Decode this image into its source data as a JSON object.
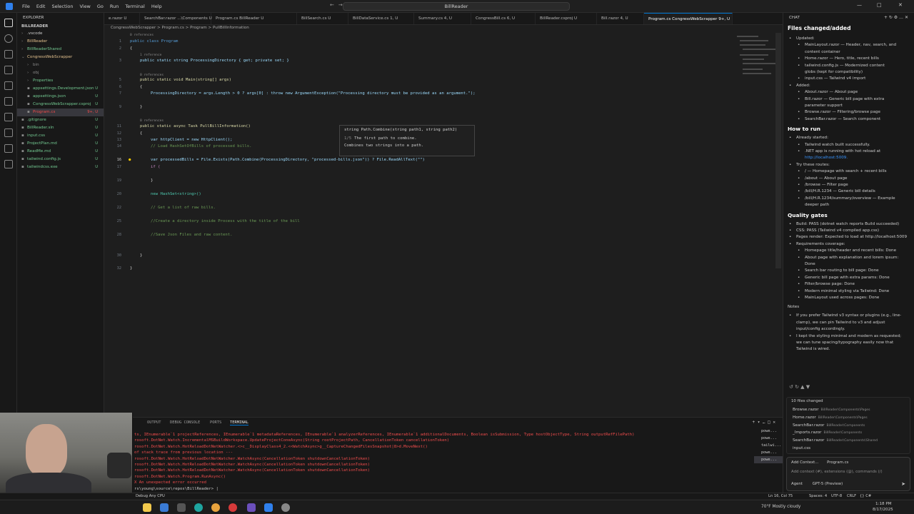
{
  "titlebar": {
    "menu": [
      "File",
      "Edit",
      "Selection",
      "View",
      "Go",
      "Run",
      "Terminal",
      "Help"
    ],
    "search": "BillReader"
  },
  "explorer": {
    "header": "EXPLORER",
    "section": "BILLREADER",
    "items": [
      {
        "label": ".vscode",
        "status": "",
        "color": "#cccccc"
      },
      {
        "label": "BillReader",
        "status": "",
        "color": "#e2c08d"
      },
      {
        "label": "BillReaderShared",
        "status": "",
        "color": "#73c991"
      },
      {
        "label": "CongressWebScrapper",
        "status": "",
        "color": "#e2c08d"
      },
      {
        "label": "bin",
        "status": "",
        "color": "#8b8b8b"
      },
      {
        "label": "obj",
        "status": "",
        "color": "#8b8b8b"
      },
      {
        "label": "Properties",
        "status": "",
        "color": "#73c991"
      },
      {
        "label": "appsettings.Development.json",
        "status": "U",
        "color": "#73c991"
      },
      {
        "label": "appsettings.json",
        "status": "U",
        "color": "#73c991"
      },
      {
        "label": "CongressWebScrapper.csproj",
        "status": "U",
        "color": "#73c991"
      },
      {
        "label": "Program.cs",
        "status": "9+, U",
        "color": "#f14c4c"
      },
      {
        "label": ".gitignore",
        "status": "U",
        "color": "#73c991"
      },
      {
        "label": "BillReader.sln",
        "status": "U",
        "color": "#73c991"
      },
      {
        "label": "input.css",
        "status": "U",
        "color": "#73c991"
      },
      {
        "label": "ProjectPlan.md",
        "status": "U",
        "color": "#73c991"
      },
      {
        "label": "ReadMe.md",
        "status": "U",
        "color": "#73c991"
      },
      {
        "label": "tailwind.config.js",
        "status": "U",
        "color": "#73c991"
      },
      {
        "label": "tailwindcss.exe",
        "status": "U",
        "color": "#73c991"
      }
    ]
  },
  "tabs": [
    {
      "label": "e.razor U"
    },
    {
      "label": "SearchBar.razor ...\\Components U"
    },
    {
      "label": "Program.cs BillReader U"
    },
    {
      "label": "BillSearch.cs U"
    },
    {
      "label": "BillDataService.cs 1, U"
    },
    {
      "label": "Summary.cs 4, U"
    },
    {
      "label": "CongressBill.cs 6, U"
    },
    {
      "label": "BillReader.csproj U"
    },
    {
      "label": "Bill.razor 4, U"
    },
    {
      "label": "Program.cs CongressWebScrapper 9+, U"
    }
  ],
  "breadcrumb": "CongressWebScrapper > Program.cs > Program > PullBillInformation",
  "code": {
    "lens": {
      "ref0": "0 references",
      "ref1": "1 reference",
      "ref0b": "0 references",
      "ref0c": "0 references"
    },
    "lines": {
      "l1": "public class Program",
      "l3": "public static string ProcessingDirectory { get; private set; }",
      "l5": "public static void Main(string[] args)",
      "l7": "ProcessingDirectory = args.Length > 0 ? args[0] : throw new ArgumentException(\"Processing directory must be provided as an argument.\");",
      "l11": "public static async Task PullBillInformation()",
      "l13": "var httpClient = new HttpClient();",
      "l14": "// Load HashSetOfBills of processed bills.",
      "l16": "var processedBills = File.Exists(Path.Combine(ProcessingDirectory, \"processed-bills.json\")) ? File.ReadAllText(\"\")",
      "l17": "if (",
      "l20": "new HashSet<string>()",
      "l22": "// Get a list of raw bills.",
      "l25": "//Create a directory inside Process with the title of the bill",
      "l28": "//Save Json Files and raw content."
    }
  },
  "hover": {
    "signature": "string Path.Combine(string path1, string path2)",
    "overload": "1/5",
    "param_doc": "The first path to combine.",
    "summary": "Combines two strings into a path."
  },
  "panel": {
    "tabs": [
      "OUTPUT",
      "DEBUG CONSOLE",
      "PORTS",
      "TERMINAL"
    ],
    "terminal_lines": [
      "ts, IEnumerable`1 projectReferences, IEnumerable`1 metadataReferences, IEnumerable`1 analyzerReferences, IEnumerable`1 additionalDocuments, Boolean isSubmission, Type hostObjectType, String outputRefFilePath)",
      "rosoft.DotNet.Watch.IncrementalMSBuildWorkspace.UpdateProjectConeAsync(String rootProjectPath, CancellationToken cancellationToken)",
      "rosoft.DotNet.Watch.HotReloadDotNetWatcher.<>c__DisplayClass4_2.<<WatchAsync>g__CaptureChangedFilesSnapshot|8>d.MoveNext()",
      "of stack trace from previous location ---",
      "rosoft.DotNet.Watch.HotReloadDotNetWatcher.WatchAsync(CancellationToken shutdownCancellationToken)",
      "rosoft.DotNet.Watch.HotReloadDotNetWatcher.WatchAsync(CancellationToken shutdownCancellationToken)",
      "rosoft.DotNet.Watch.HotReloadDotNetWatcher.WatchAsync(CancellationToken shutdownCancellationToken)",
      "rosoft.DotNet.Watch.Program.RunAsync()",
      "X An unexpected error occurred",
      "rs\\young\\source\\repos\\BillReader> |"
    ],
    "terminal_list": [
      "powe...",
      "powe...",
      "tailwi...",
      "powe...",
      "powe..."
    ]
  },
  "chat": {
    "title": "CHAT",
    "files_heading": "Files changed/added",
    "updated_label": "Updated:",
    "updated": [
      "MainLayout.razor — Header, nav, search, and",
      "content container",
      "Home.razor — Hero, title, recent bills",
      "tailwind.config.js — Modernized content",
      "globs (kept for compatibility)",
      "input.css — Tailwind v4 import"
    ],
    "added_label": "Added:",
    "added": [
      "About.razor — About page",
      "Bill.razor — Generic bill page with extra",
      "parameter support",
      "Browse.razor — Filtering/browse page",
      "SearchBar.razor — Search component"
    ],
    "how_heading": "How to run",
    "already_started": "Already started:",
    "how": [
      "Tailwind watch built successfully.",
      ".NET app is running with hot reload at",
      "http://localhost:5009."
    ],
    "try_routes": "Try these routes:",
    "routes": [
      "/ — Homepage with search + recent bills",
      "/about — About page",
      "/browse — Filter page",
      "/bill/H.R.1234 — Generic bill details",
      "/bill/H.R.1234/summary/overview — Example",
      "deeper path"
    ],
    "quality_heading": "Quality gates",
    "quality": [
      "Build: PASS (dotnet watch reports Build succeeded)",
      "CSS: PASS (Tailwind v4 compiled app.css)",
      "Pages render: Expected to load at http://localhost:5009",
      "Requirements coverage:",
      "Homepage title/header and recent bills: Done",
      "About page with explanation and lorem ipsum:",
      "Done",
      "Search bar routing to bill page: Done",
      "Generic bill page with extra params: Done",
      "Filter/browse page: Done",
      "Modern minimal styling via Tailwind: Done",
      "MainLayout used across pages: Done"
    ],
    "notes_heading": "Notes",
    "notes": [
      "If you prefer Tailwind v3 syntax or plugins (e.g., line-",
      "clamp), we can pin Tailwind to v3 and adjust",
      "input/config accordingly.",
      "I kept the styling minimal and modern as requested;",
      "we can tune spacing/typography easily now that",
      "Tailwind is wired."
    ],
    "files_changed_count": "10 files changed",
    "changed_files": [
      {
        "name": "Browse.razor",
        "path": "BillReader\\Components\\Pages"
      },
      {
        "name": "Home.razor",
        "path": "BillReader\\Components\\Pages"
      },
      {
        "name": "SearchBar.razor",
        "path": "BillReader\\Components"
      },
      {
        "name": "_Imports.razor",
        "path": "BillReader\\Components"
      },
      {
        "name": "SearchBar.razor",
        "path": "BillReader\\Components\\Shared"
      },
      {
        "name": "input.css",
        "path": ""
      }
    ],
    "input": {
      "add_context": "Add Context...",
      "context_file": "Program.cs",
      "placeholder": "Add context (#), extensions (@), commands (/)",
      "mode": "Agent",
      "model": "GPT-5 (Preview)"
    }
  },
  "statusbar": {
    "left": "Debug Any CPU",
    "position": "Ln 16, Col 75",
    "spaces": "Spaces: 4",
    "encoding": "UTF-8",
    "eol": "CRLF",
    "language": "{} C#"
  },
  "taskbar": {
    "weather": "70°F Mostly cloudy",
    "time": "1:18 PM",
    "date": "8/17/2025"
  }
}
